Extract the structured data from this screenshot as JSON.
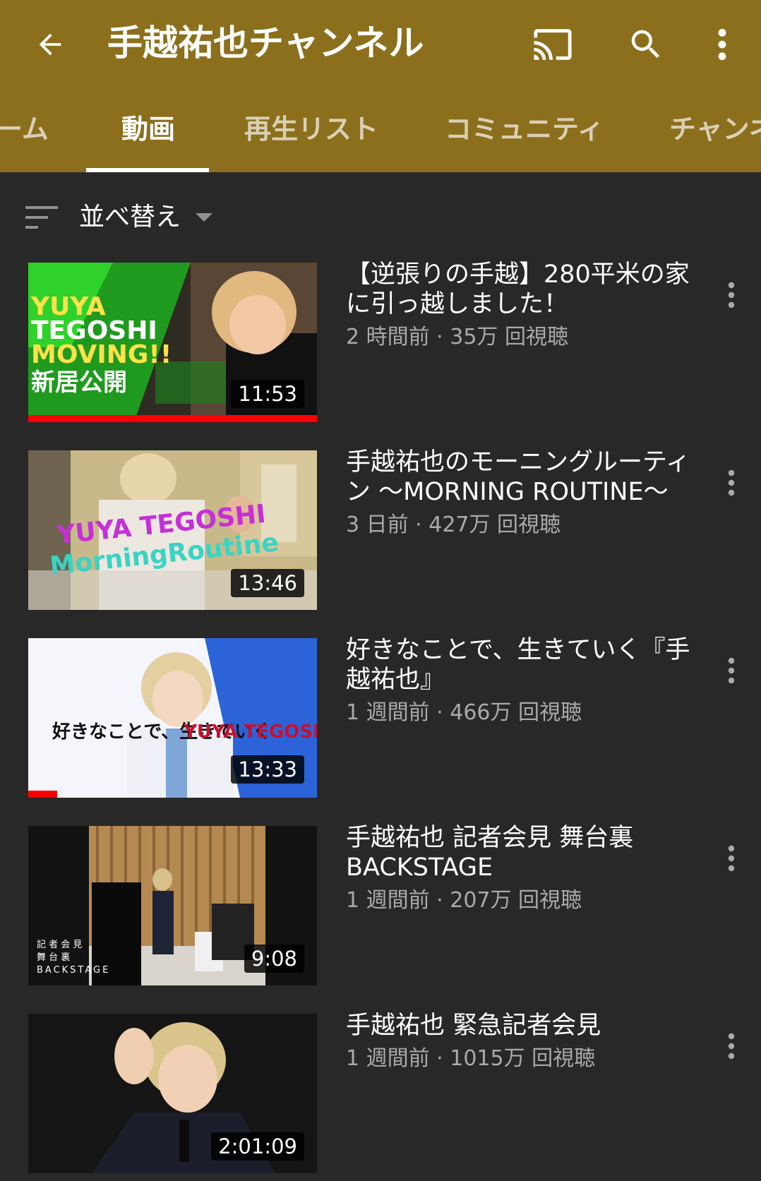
{
  "header": {
    "title": "手越祐也チャンネル",
    "back_icon": "arrow-back-icon",
    "cast_icon": "cast-icon",
    "search_icon": "search-icon",
    "more_icon": "more-vert-icon",
    "background_color": "#8c6f1c"
  },
  "tabs": [
    {
      "label": "ーム",
      "active": false
    },
    {
      "label": "動画",
      "active": true
    },
    {
      "label": "再生リスト",
      "active": false
    },
    {
      "label": "コミュニティ",
      "active": false
    },
    {
      "label": "チャンネ",
      "active": false
    }
  ],
  "sort": {
    "label": "並べ替え",
    "icon": "sort-icon",
    "caret_icon": "dropdown-caret-icon"
  },
  "videos": [
    {
      "title": "【逆張りの手越】280平米の家に引っ越しました！",
      "meta": "2 時間前 · 35万 回視聴",
      "duration": "11:53",
      "watched_fraction": 1.0,
      "thumb_text": [
        "YUYA",
        "TEGOSHI",
        "MOVING!!",
        "新居公開"
      ]
    },
    {
      "title": "手越祐也のモーニングルーティン ～MORNING ROUTINE～",
      "meta": "3 日前 · 427万 回視聴",
      "duration": "13:46",
      "watched_fraction": 0,
      "thumb_text": [
        "YUYA TEGOSHI",
        "MorningRoutine"
      ]
    },
    {
      "title": "好きなことで、生きていく『手越祐也』",
      "meta": "1 週間前 · 466万 回視聴",
      "duration": "13:33",
      "watched_fraction": 0.1,
      "thumb_text": [
        "好きなことで、生きていく",
        "YUYA TEGOSHI"
      ]
    },
    {
      "title": "手越祐也 記者会見 舞台裏 BACKSTAGE",
      "meta": "1 週間前 · 207万 回視聴",
      "duration": "9:08",
      "watched_fraction": 0,
      "thumb_text": [
        "記 者 会 見",
        "舞 台 裏",
        "BACKSTAGE"
      ]
    },
    {
      "title": "手越祐也 緊急記者会見",
      "meta": "1 週間前 · 1015万 回視聴",
      "duration": "2:01:09",
      "watched_fraction": 0,
      "thumb_text": []
    }
  ],
  "colors": {
    "background": "#282828",
    "meta_text": "#aaaaaa",
    "progress": "#ff0000"
  }
}
